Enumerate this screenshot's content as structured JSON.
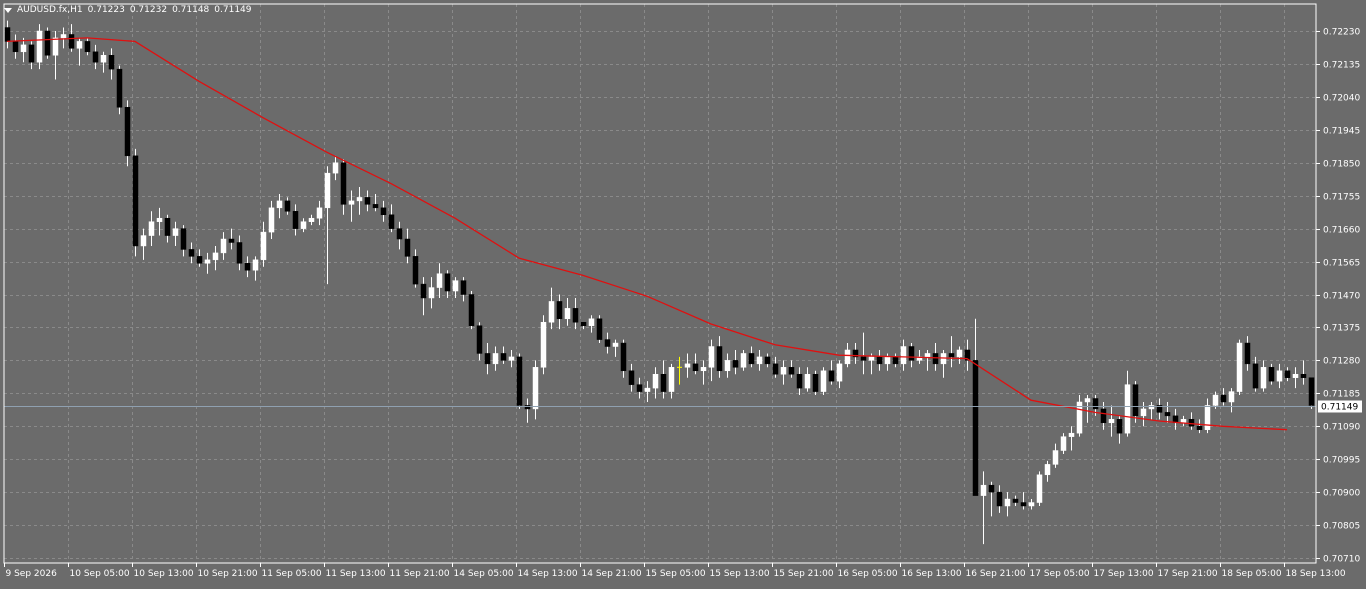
{
  "header": {
    "symbol": "AUDUSD.fx,H1",
    "open": "0.71223",
    "high": "0.71232",
    "low": "0.71148",
    "close": "0.71149"
  },
  "colors": {
    "background": "#6b6b6b",
    "grid": "#8a8a8a",
    "axis_text": "#ffffff",
    "bull_body": "#ffffff",
    "bear_body": "#000000",
    "wick": "#ffffff",
    "doji_wick": "#ffff00",
    "ma_line": "#e01010",
    "price_line": "#8fa0b0"
  },
  "chart_data": {
    "type": "candlestick",
    "symbol": "AUDUSD.fx",
    "timeframe": "H1",
    "grid": true,
    "ylim": [
      0.7071,
      0.7232
    ],
    "y_ticks": [
      "0.72230",
      "0.72135",
      "0.72040",
      "0.71945",
      "0.71850",
      "0.71755",
      "0.71660",
      "0.71565",
      "0.71470",
      "0.71375",
      "0.71280",
      "0.71185",
      "0.71090",
      "0.70995",
      "0.70900",
      "0.70805",
      "0.70710"
    ],
    "x_ticks": [
      {
        "label": "9 Sep 2026",
        "index": 0
      },
      {
        "label": "10 Sep 05:00",
        "index": 8
      },
      {
        "label": "10 Sep 13:00",
        "index": 16
      },
      {
        "label": "10 Sep 21:00",
        "index": 24
      },
      {
        "label": "11 Sep 05:00",
        "index": 32
      },
      {
        "label": "11 Sep 13:00",
        "index": 40
      },
      {
        "label": "11 Sep 21:00",
        "index": 48
      },
      {
        "label": "14 Sep 05:00",
        "index": 56
      },
      {
        "label": "14 Sep 13:00",
        "index": 64
      },
      {
        "label": "14 Sep 21:00",
        "index": 72
      },
      {
        "label": "15 Sep 05:00",
        "index": 80
      },
      {
        "label": "15 Sep 13:00",
        "index": 88
      },
      {
        "label": "15 Sep 21:00",
        "index": 96
      },
      {
        "label": "16 Sep 05:00",
        "index": 104
      },
      {
        "label": "16 Sep 13:00",
        "index": 112
      },
      {
        "label": "16 Sep 21:00",
        "index": 120
      },
      {
        "label": "17 Sep 05:00",
        "index": 128
      },
      {
        "label": "17 Sep 13:00",
        "index": 136
      },
      {
        "label": "17 Sep 21:00",
        "index": 144
      },
      {
        "label": "18 Sep 05:00",
        "index": 152
      },
      {
        "label": "18 Sep 13:00",
        "index": 160
      }
    ],
    "candles": [
      [
        0.7224,
        0.7226,
        0.7218,
        0.722
      ],
      [
        0.722,
        0.7222,
        0.7215,
        0.7217
      ],
      [
        0.7217,
        0.7221,
        0.7214,
        0.7219
      ],
      [
        0.7219,
        0.722,
        0.7212,
        0.7214
      ],
      [
        0.7214,
        0.7225,
        0.7212,
        0.7223
      ],
      [
        0.7223,
        0.7224,
        0.7215,
        0.7216
      ],
      [
        0.7216,
        0.7223,
        0.7209,
        0.7221
      ],
      [
        0.7221,
        0.7224,
        0.7218,
        0.7222
      ],
      [
        0.7222,
        0.7225,
        0.7217,
        0.7218
      ],
      [
        0.7218,
        0.7221,
        0.7213,
        0.722
      ],
      [
        0.722,
        0.7221,
        0.7216,
        0.7217
      ],
      [
        0.7217,
        0.7219,
        0.7212,
        0.7214
      ],
      [
        0.7214,
        0.7217,
        0.7211,
        0.7216
      ],
      [
        0.7216,
        0.7218,
        0.7209,
        0.7212
      ],
      [
        0.7212,
        0.7213,
        0.7199,
        0.7201
      ],
      [
        0.7201,
        0.7203,
        0.7184,
        0.7187
      ],
      [
        0.7187,
        0.7189,
        0.7158,
        0.7161
      ],
      [
        0.7161,
        0.7166,
        0.7157,
        0.7164
      ],
      [
        0.7164,
        0.7171,
        0.7161,
        0.7168
      ],
      [
        0.7168,
        0.7172,
        0.7164,
        0.7169
      ],
      [
        0.7169,
        0.717,
        0.7162,
        0.7164
      ],
      [
        0.7164,
        0.7168,
        0.7161,
        0.7166
      ],
      [
        0.7166,
        0.7167,
        0.7158,
        0.716
      ],
      [
        0.716,
        0.7162,
        0.7156,
        0.7158
      ],
      [
        0.7158,
        0.716,
        0.7155,
        0.7156
      ],
      [
        0.7156,
        0.7159,
        0.7153,
        0.7157
      ],
      [
        0.7157,
        0.7161,
        0.7154,
        0.7159
      ],
      [
        0.7159,
        0.7165,
        0.7157,
        0.7163
      ],
      [
        0.7163,
        0.7166,
        0.716,
        0.7162
      ],
      [
        0.7162,
        0.7164,
        0.7154,
        0.7156
      ],
      [
        0.7156,
        0.7158,
        0.7152,
        0.7154
      ],
      [
        0.7154,
        0.7158,
        0.7151,
        0.7157
      ],
      [
        0.7157,
        0.7168,
        0.7155,
        0.7165
      ],
      [
        0.7165,
        0.7174,
        0.7163,
        0.7172
      ],
      [
        0.7172,
        0.7176,
        0.7169,
        0.7174
      ],
      [
        0.7174,
        0.7175,
        0.717,
        0.7171
      ],
      [
        0.7171,
        0.7173,
        0.7164,
        0.7166
      ],
      [
        0.7166,
        0.7169,
        0.7165,
        0.7168
      ],
      [
        0.7168,
        0.717,
        0.7167,
        0.7169
      ],
      [
        0.7169,
        0.7174,
        0.7167,
        0.7172
      ],
      [
        0.7172,
        0.7184,
        0.715,
        0.7182
      ],
      [
        0.7182,
        0.7187,
        0.718,
        0.7185
      ],
      [
        0.7185,
        0.7186,
        0.717,
        0.7173
      ],
      [
        0.7173,
        0.7177,
        0.7168,
        0.7174
      ],
      [
        0.7174,
        0.7178,
        0.717,
        0.7175
      ],
      [
        0.7175,
        0.7177,
        0.7171,
        0.7173
      ],
      [
        0.7173,
        0.7176,
        0.7171,
        0.7172
      ],
      [
        0.7172,
        0.7174,
        0.7168,
        0.717
      ],
      [
        0.717,
        0.7173,
        0.7165,
        0.7166
      ],
      [
        0.7166,
        0.7168,
        0.716,
        0.7163
      ],
      [
        0.7163,
        0.7166,
        0.7156,
        0.7158
      ],
      [
        0.7158,
        0.716,
        0.7149,
        0.715
      ],
      [
        0.715,
        0.7152,
        0.7141,
        0.7146
      ],
      [
        0.7146,
        0.7152,
        0.7143,
        0.7149
      ],
      [
        0.7149,
        0.7156,
        0.7146,
        0.7153
      ],
      [
        0.7153,
        0.7154,
        0.7146,
        0.7148
      ],
      [
        0.7148,
        0.7152,
        0.7146,
        0.7151
      ],
      [
        0.7151,
        0.7152,
        0.7145,
        0.7147
      ],
      [
        0.7147,
        0.7148,
        0.7137,
        0.7138
      ],
      [
        0.7138,
        0.7139,
        0.7128,
        0.713
      ],
      [
        0.713,
        0.7133,
        0.7124,
        0.7127
      ],
      [
        0.7127,
        0.7132,
        0.7125,
        0.713
      ],
      [
        0.713,
        0.7132,
        0.7127,
        0.7128
      ],
      [
        0.7128,
        0.7131,
        0.7126,
        0.7129
      ],
      [
        0.7129,
        0.713,
        0.7114,
        0.7115
      ],
      [
        0.7115,
        0.7117,
        0.711,
        0.7114
      ],
      [
        0.7114,
        0.7128,
        0.7111,
        0.7126
      ],
      [
        0.7126,
        0.7141,
        0.7124,
        0.7139
      ],
      [
        0.7139,
        0.7149,
        0.7137,
        0.7145
      ],
      [
        0.7145,
        0.7147,
        0.7137,
        0.714
      ],
      [
        0.714,
        0.7146,
        0.7138,
        0.7143
      ],
      [
        0.7143,
        0.7146,
        0.7137,
        0.7139
      ],
      [
        0.7139,
        0.7139,
        0.7137,
        0.7138
      ],
      [
        0.7138,
        0.7141,
        0.7136,
        0.714
      ],
      [
        0.714,
        0.7141,
        0.7133,
        0.7134
      ],
      [
        0.7134,
        0.7136,
        0.713,
        0.7132
      ],
      [
        0.7132,
        0.7134,
        0.7129,
        0.7133
      ],
      [
        0.7133,
        0.7134,
        0.7123,
        0.7125
      ],
      [
        0.7125,
        0.7127,
        0.7119,
        0.7121
      ],
      [
        0.7121,
        0.7123,
        0.7117,
        0.7119
      ],
      [
        0.7119,
        0.7122,
        0.7116,
        0.712
      ],
      [
        0.712,
        0.7126,
        0.7117,
        0.7124
      ],
      [
        0.7124,
        0.7128,
        0.7117,
        0.7119
      ],
      [
        0.7119,
        0.7127,
        0.7117,
        0.7126
      ],
      [
        0.7126,
        0.7129,
        0.7121,
        0.7126
      ],
      [
        0.7126,
        0.713,
        0.7123,
        0.7127
      ],
      [
        0.7127,
        0.713,
        0.7124,
        0.7125
      ],
      [
        0.7125,
        0.7128,
        0.7121,
        0.7126
      ],
      [
        0.7126,
        0.7134,
        0.7122,
        0.7132
      ],
      [
        0.7132,
        0.7135,
        0.7123,
        0.7125
      ],
      [
        0.7125,
        0.713,
        0.7123,
        0.7128
      ],
      [
        0.7128,
        0.7131,
        0.7124,
        0.7126
      ],
      [
        0.7126,
        0.7131,
        0.7125,
        0.713
      ],
      [
        0.713,
        0.7132,
        0.7126,
        0.7127
      ],
      [
        0.7127,
        0.7131,
        0.7125,
        0.7129
      ],
      [
        0.7129,
        0.713,
        0.7126,
        0.7127
      ],
      [
        0.7127,
        0.7129,
        0.7123,
        0.7124
      ],
      [
        0.7124,
        0.7128,
        0.7121,
        0.7126
      ],
      [
        0.7126,
        0.7128,
        0.7123,
        0.7124
      ],
      [
        0.7124,
        0.7126,
        0.7118,
        0.712
      ],
      [
        0.712,
        0.7126,
        0.7119,
        0.7124
      ],
      [
        0.7124,
        0.7125,
        0.7118,
        0.7119
      ],
      [
        0.7119,
        0.7126,
        0.7118,
        0.7125
      ],
      [
        0.7125,
        0.7128,
        0.7121,
        0.7122
      ],
      [
        0.7122,
        0.7128,
        0.712,
        0.7127
      ],
      [
        0.7127,
        0.7133,
        0.7126,
        0.7131
      ],
      [
        0.7131,
        0.7133,
        0.7127,
        0.7129
      ],
      [
        0.7129,
        0.7136,
        0.7124,
        0.7128
      ],
      [
        0.7128,
        0.713,
        0.7124,
        0.7129
      ],
      [
        0.7129,
        0.7131,
        0.7125,
        0.7127
      ],
      [
        0.7127,
        0.713,
        0.7125,
        0.7129
      ],
      [
        0.7129,
        0.713,
        0.7126,
        0.7127
      ],
      [
        0.7127,
        0.7134,
        0.7125,
        0.7132
      ],
      [
        0.7132,
        0.7133,
        0.7126,
        0.7128
      ],
      [
        0.7128,
        0.7131,
        0.7127,
        0.7129
      ],
      [
        0.7129,
        0.7131,
        0.7125,
        0.713
      ],
      [
        0.713,
        0.7133,
        0.7125,
        0.7127
      ],
      [
        0.7127,
        0.7131,
        0.7123,
        0.713
      ],
      [
        0.713,
        0.7135,
        0.7126,
        0.7129
      ],
      [
        0.7129,
        0.7132,
        0.7127,
        0.7131
      ],
      [
        0.7131,
        0.7134,
        0.7125,
        0.7128
      ],
      [
        0.7128,
        0.714,
        0.7126,
        0.7089
      ],
      [
        0.7089,
        0.7096,
        0.7075,
        0.7092
      ],
      [
        0.7092,
        0.7093,
        0.7083,
        0.709
      ],
      [
        0.709,
        0.7092,
        0.7084,
        0.7086
      ],
      [
        0.7086,
        0.709,
        0.7083,
        0.7088
      ],
      [
        0.7088,
        0.7089,
        0.7086,
        0.7087
      ],
      [
        0.7087,
        0.709,
        0.7085,
        0.7086
      ],
      [
        0.7086,
        0.7088,
        0.7085,
        0.7087
      ],
      [
        0.7087,
        0.7096,
        0.7086,
        0.7095
      ],
      [
        0.7095,
        0.7099,
        0.7093,
        0.7098
      ],
      [
        0.7098,
        0.7104,
        0.7097,
        0.7102
      ],
      [
        0.7102,
        0.7107,
        0.7101,
        0.7106
      ],
      [
        0.7106,
        0.7109,
        0.7102,
        0.7107
      ],
      [
        0.7107,
        0.7118,
        0.7106,
        0.7116
      ],
      [
        0.7116,
        0.7118,
        0.711,
        0.7117
      ],
      [
        0.7117,
        0.7118,
        0.7112,
        0.7114
      ],
      [
        0.7114,
        0.7116,
        0.7108,
        0.711
      ],
      [
        0.711,
        0.7115,
        0.7106,
        0.7111
      ],
      [
        0.7111,
        0.7112,
        0.7104,
        0.7107
      ],
      [
        0.7107,
        0.7125,
        0.7106,
        0.7121
      ],
      [
        0.7121,
        0.7122,
        0.711,
        0.7112
      ],
      [
        0.7112,
        0.7116,
        0.7109,
        0.7114
      ],
      [
        0.7114,
        0.7116,
        0.7111,
        0.7115
      ],
      [
        0.7115,
        0.7117,
        0.7111,
        0.7113
      ],
      [
        0.7113,
        0.7116,
        0.711,
        0.7112
      ],
      [
        0.7112,
        0.7114,
        0.7108,
        0.711
      ],
      [
        0.711,
        0.7112,
        0.7109,
        0.7111
      ],
      [
        0.7111,
        0.7113,
        0.7108,
        0.7109
      ],
      [
        0.7109,
        0.7111,
        0.7107,
        0.7108
      ],
      [
        0.7108,
        0.7117,
        0.7107,
        0.7115
      ],
      [
        0.7115,
        0.7119,
        0.7114,
        0.7118
      ],
      [
        0.7118,
        0.712,
        0.7115,
        0.7116
      ],
      [
        0.7116,
        0.712,
        0.7113,
        0.7119
      ],
      [
        0.7119,
        0.7134,
        0.7118,
        0.7133
      ],
      [
        0.7133,
        0.7135,
        0.7125,
        0.7127
      ],
      [
        0.7127,
        0.7129,
        0.7119,
        0.712
      ],
      [
        0.712,
        0.7128,
        0.7119,
        0.7126
      ],
      [
        0.7126,
        0.7127,
        0.7121,
        0.7122
      ],
      [
        0.7122,
        0.7127,
        0.712,
        0.7125
      ],
      [
        0.7125,
        0.7126,
        0.7122,
        0.7123
      ],
      [
        0.7123,
        0.7126,
        0.712,
        0.7124
      ],
      [
        0.7124,
        0.7128,
        0.7121,
        0.7123
      ],
      [
        0.7123,
        0.7123,
        0.7114,
        0.7115
      ]
    ],
    "moving_average": {
      "x": [
        0,
        10,
        16,
        24,
        32,
        40,
        48,
        56,
        64,
        72,
        80,
        88,
        96,
        104,
        112,
        120,
        128,
        136,
        144,
        152,
        160
      ],
      "y": [
        0.722,
        0.7221,
        0.722,
        0.72085,
        0.7198,
        0.7188,
        0.7179,
        0.7169,
        0.71575,
        0.71525,
        0.71465,
        0.71385,
        0.71325,
        0.71295,
        0.7129,
        0.71285,
        0.71165,
        0.7113,
        0.71105,
        0.7109,
        0.7108
      ]
    },
    "current_price": "0.71149"
  }
}
